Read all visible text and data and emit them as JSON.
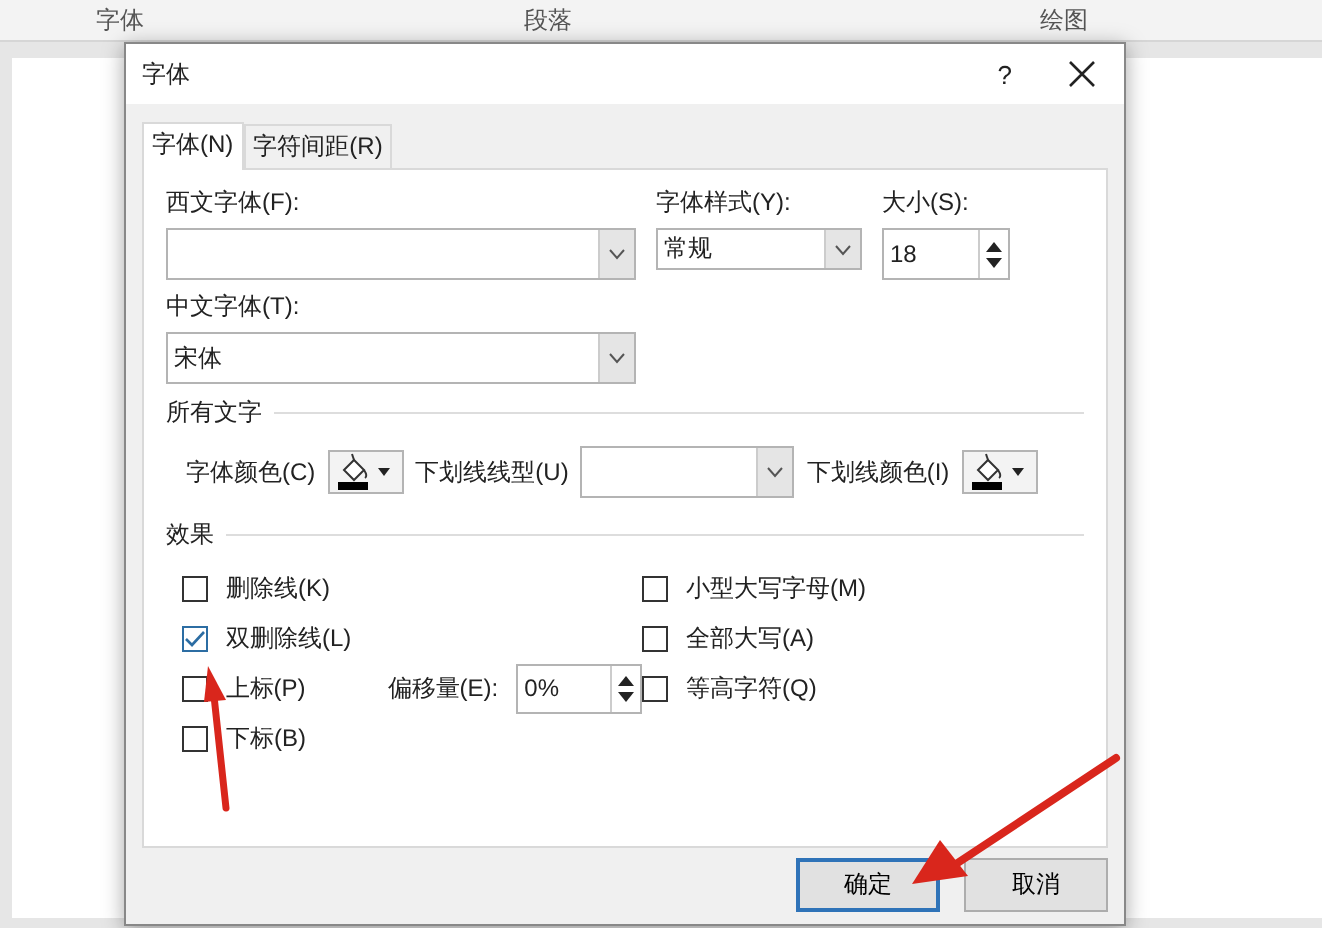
{
  "ribbon": {
    "groups": [
      "字体",
      "段落",
      "绘图"
    ]
  },
  "dialog": {
    "title": "字体",
    "help": "?",
    "tabs": [
      {
        "label": "字体(N)",
        "selected": true
      },
      {
        "label": "字符间距(R)",
        "selected": false
      }
    ],
    "western_font": {
      "label": "西文字体(F):"
    },
    "font_style": {
      "label": "字体样式(Y):",
      "value": "常规"
    },
    "size": {
      "label": "大小(S):",
      "value": "18"
    },
    "asian_font": {
      "label": "中文字体(T):",
      "value": "宋体"
    },
    "all_text": {
      "heading": "所有文字",
      "font_color_label": "字体颜色(C)",
      "underline_style_label": "下划线线型(U)",
      "underline_color_label": "下划线颜色(I)"
    },
    "effects": {
      "heading": "效果",
      "left": [
        {
          "label": "删除线(K)",
          "checked": false
        },
        {
          "label": "双删除线(L)",
          "checked": true
        },
        {
          "label": "上标(P)",
          "checked": false
        },
        {
          "label": "下标(B)",
          "checked": false
        }
      ],
      "right": [
        {
          "label": "小型大写字母(M)",
          "checked": false
        },
        {
          "label": "全部大写(A)",
          "checked": false
        },
        {
          "label": "等高字符(Q)",
          "checked": false
        }
      ],
      "offset": {
        "label": "偏移量(E):",
        "value": "0%"
      }
    },
    "buttons": [
      {
        "label": "确定",
        "selected": true
      },
      {
        "label": "取消",
        "selected": false
      }
    ]
  }
}
